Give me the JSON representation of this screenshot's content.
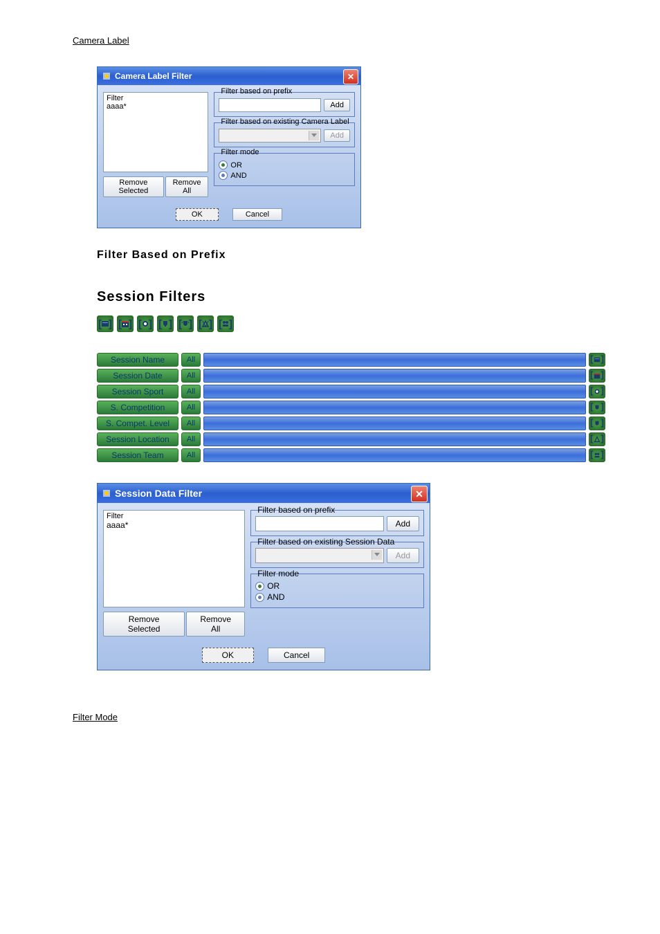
{
  "top_link": "Camera Label",
  "dialog1": {
    "title": "Camera Label Filter",
    "filter_header": "Filter",
    "filter_item": "aaaa*",
    "remove_selected": "Remove Selected",
    "remove_all": "Remove All",
    "prefix_legend": "Filter based on prefix",
    "existing_legend": "Filter based on existing Camera Label",
    "mode_legend": "Filter mode",
    "add": "Add",
    "or": "OR",
    "and": "AND",
    "ok": "OK",
    "cancel": "Cancel"
  },
  "heading_prefix": "Filter  Based  on  Prefix",
  "heading_session": "Session  Filters",
  "session_rows": [
    {
      "label": "Session Name",
      "all": "All"
    },
    {
      "label": "Session Date",
      "all": "All"
    },
    {
      "label": "Session Sport",
      "all": "All"
    },
    {
      "label": "S. Competition",
      "all": "All"
    },
    {
      "label": "S. Compet. Level",
      "all": "All"
    },
    {
      "label": "Session Location",
      "all": "All"
    },
    {
      "label": "Session Team",
      "all": "All"
    }
  ],
  "dialog2": {
    "title": "Session Data Filter",
    "filter_header": "Filter",
    "filter_item": "aaaa*",
    "remove_selected": "Remove Selected",
    "remove_all": "Remove All",
    "prefix_legend": "Filter based on prefix",
    "existing_legend": "Filter based on existing Session Data",
    "mode_legend": "Filter mode",
    "add": "Add",
    "or": "OR",
    "and": "AND",
    "ok": "OK",
    "cancel": "Cancel"
  },
  "bottom_link": "Filter Mode"
}
